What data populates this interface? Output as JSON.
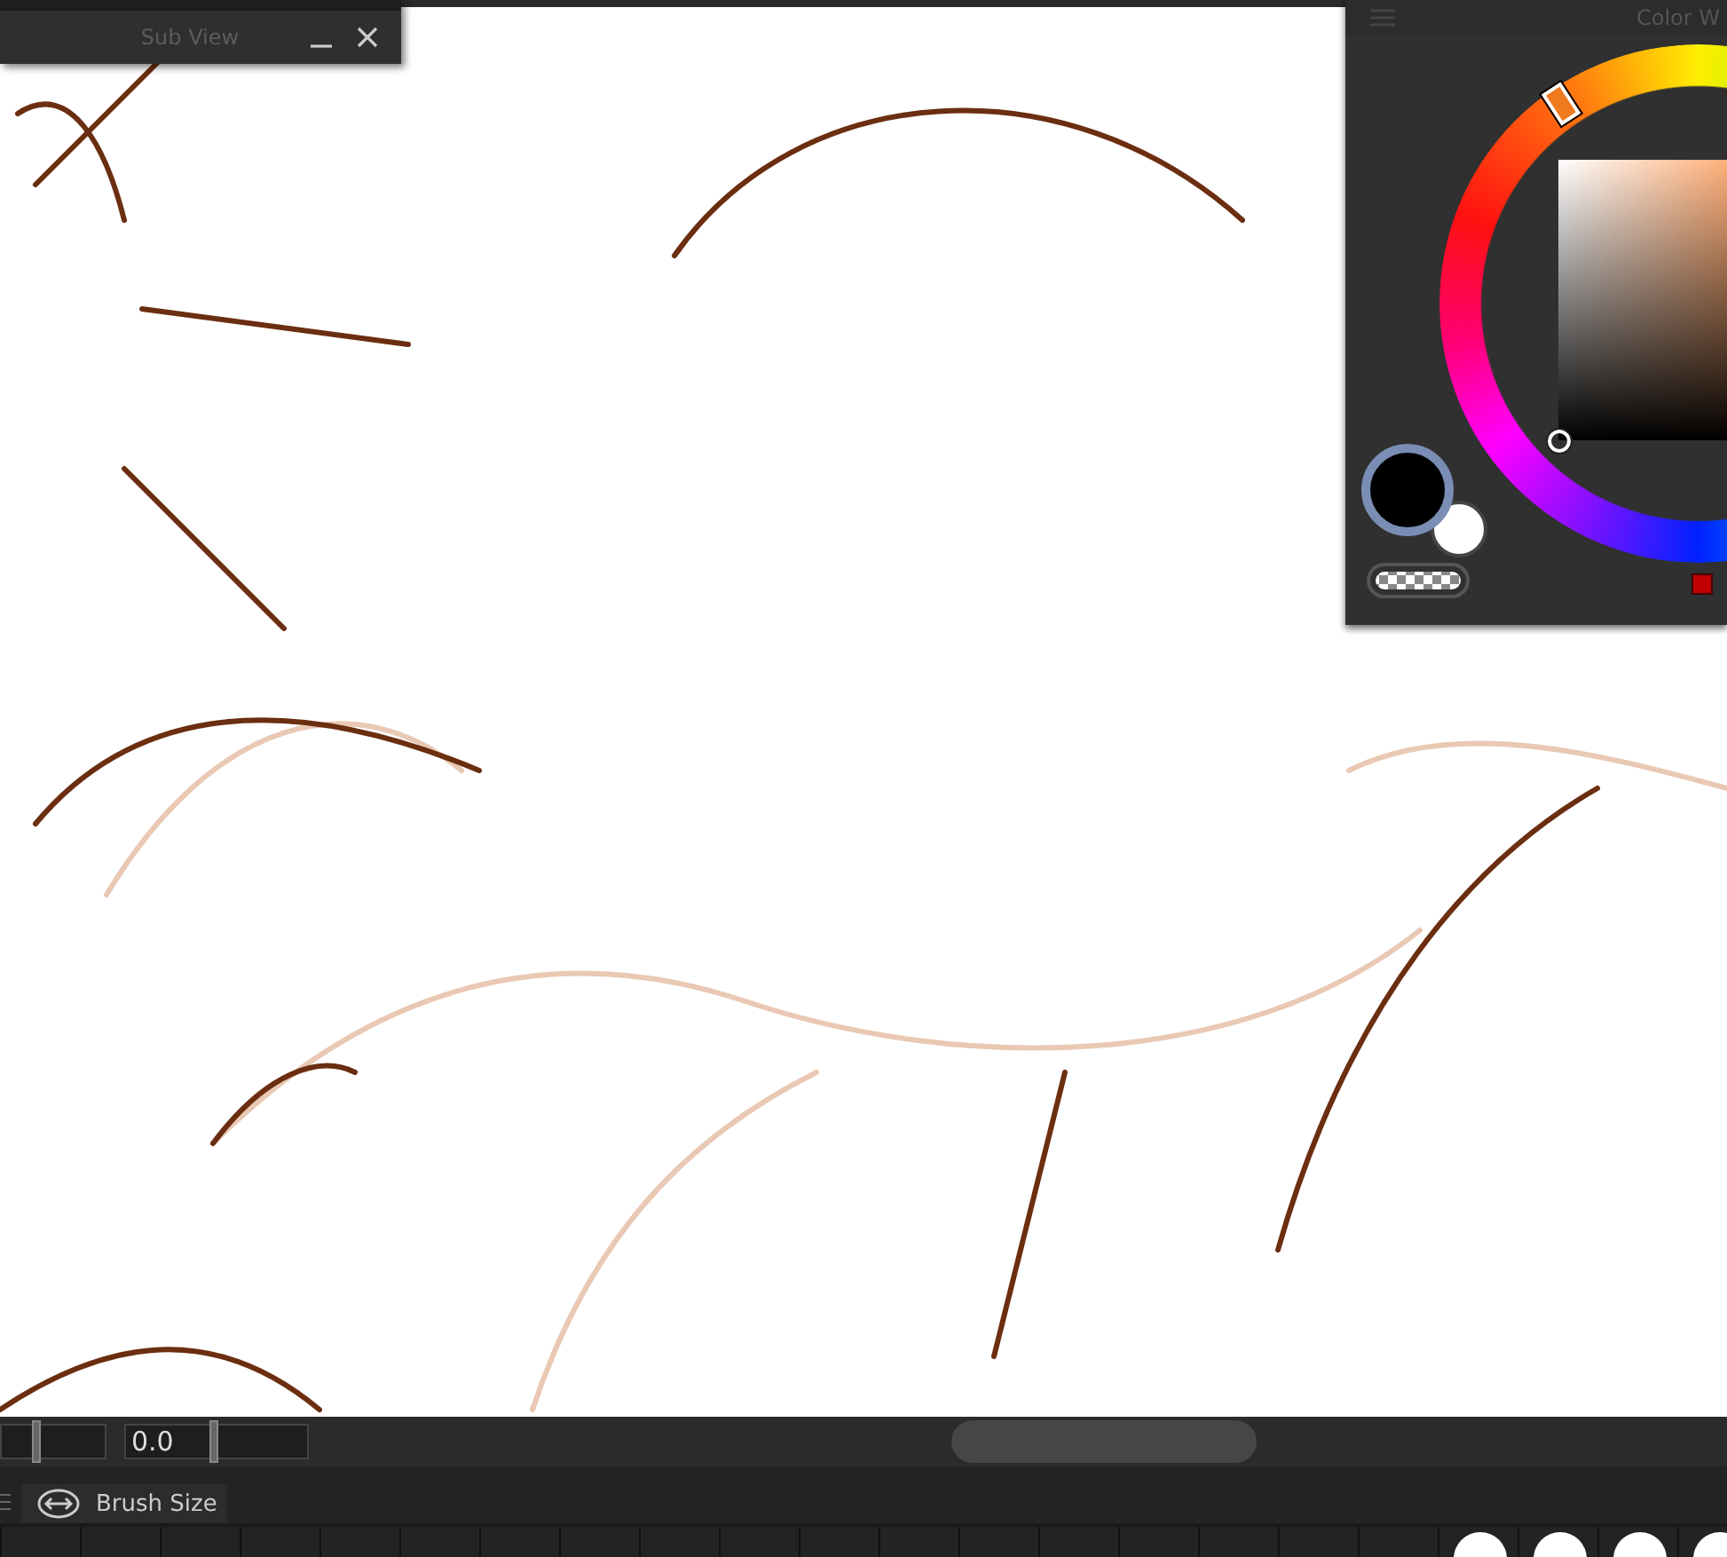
{
  "sub_view": {
    "title": "Sub View"
  },
  "color_wheel": {
    "title": "Color W",
    "swatches": [
      {
        "kind": "main",
        "color": "#000000",
        "selected": true
      },
      {
        "kind": "sub",
        "color": "#ffffff",
        "selected": false
      }
    ]
  },
  "zoom": {
    "level": 0.3
  },
  "rotation": {
    "value": "0.0",
    "level": 0.47
  },
  "tool_property": {
    "tabs": [
      {
        "label": "Brush Size",
        "selected": true
      }
    ]
  }
}
